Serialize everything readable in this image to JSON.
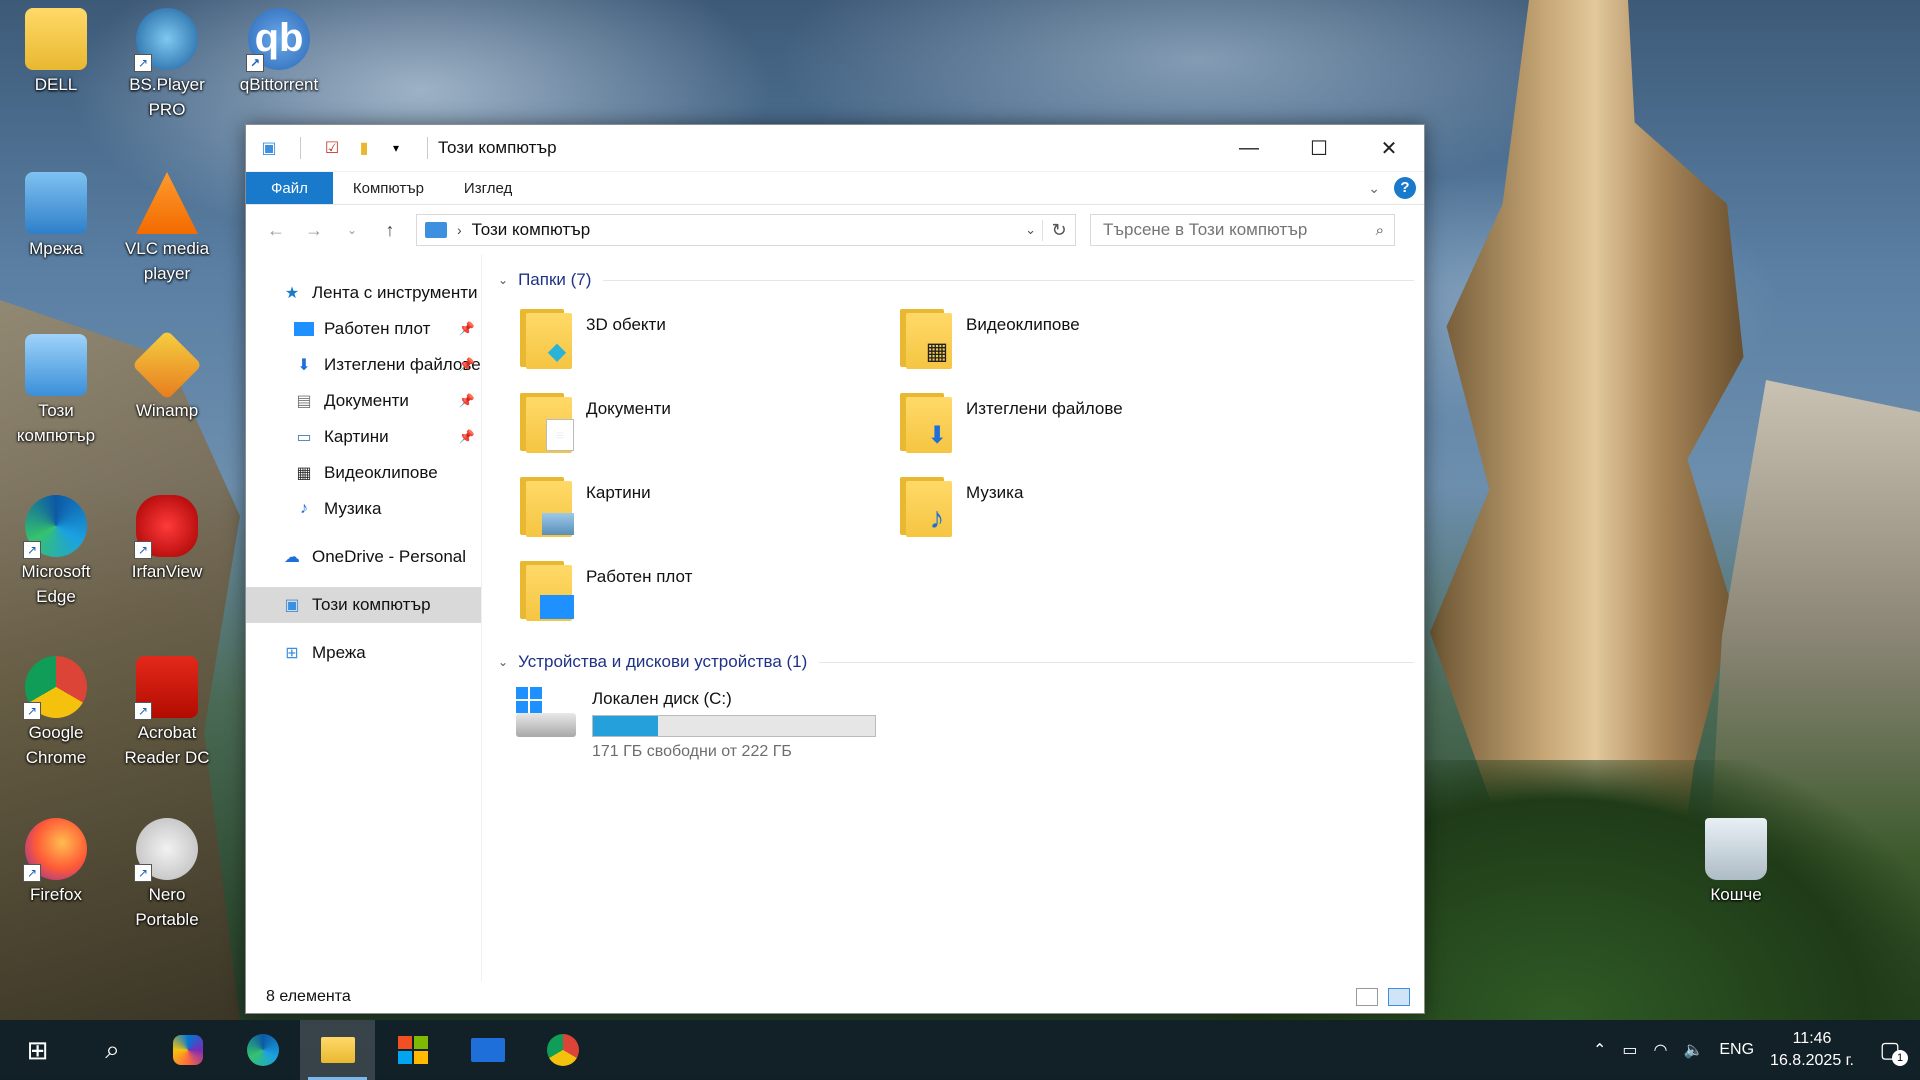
{
  "desktop": {
    "icons": [
      {
        "label": "DELL",
        "icon": "user-folder-icon"
      },
      {
        "label": "BS.Player PRO",
        "icon": "bsplayer-icon"
      },
      {
        "label": "qBittorrent",
        "icon": "qbittorrent-icon"
      },
      {
        "label": "Мрежа",
        "icon": "network-icon"
      },
      {
        "label": "VLC media player",
        "icon": "vlc-icon"
      },
      {
        "label": "Този компютър",
        "icon": "this-pc-icon"
      },
      {
        "label": "Winamp",
        "icon": "winamp-icon"
      },
      {
        "label": "Microsoft Edge",
        "icon": "edge-icon"
      },
      {
        "label": "IrfanView",
        "icon": "irfanview-icon"
      },
      {
        "label": "Google Chrome",
        "icon": "chrome-icon"
      },
      {
        "label": "Acrobat Reader DC",
        "icon": "acrobat-icon"
      },
      {
        "label": "Firefox",
        "icon": "firefox-icon"
      },
      {
        "label": "Nero Portable",
        "icon": "nero-icon"
      },
      {
        "label": "Кошче",
        "icon": "recycle-bin-icon"
      }
    ]
  },
  "window": {
    "title": "Този компютър",
    "ribbon_tabs": [
      "Файл",
      "Компютър",
      "Изглед"
    ],
    "address": {
      "location": "Този компютър"
    },
    "search": {
      "placeholder": "Търсене в Този компютър"
    },
    "nav_pane": {
      "quick_access": "Лента с инструменти",
      "pinned": [
        "Работен плот",
        "Изтеглени файлове",
        "Документи",
        "Картини"
      ],
      "unpinned": [
        "Видеоклипове",
        "Музика"
      ],
      "onedrive": "OneDrive - Personal",
      "this_pc": "Този компютър",
      "network": "Мрежа"
    },
    "folders_group": "Папки (7)",
    "folders": [
      "3D обекти",
      "Видеоклипове",
      "Документи",
      "Изтеглени файлове",
      "Картини",
      "Музика",
      "Работен плот"
    ],
    "devices_group": "Устройства и дискови устройства (1)",
    "drive": {
      "name": "Локален диск (C:)",
      "free_text": "171 ГБ свободни от 222 ГБ",
      "used_fraction": 0.23
    },
    "status_text": "8 елемента"
  },
  "taskbar": {
    "items": [
      "start-icon",
      "search-icon",
      "copilot-icon",
      "edge-icon",
      "file-explorer-icon",
      "store-icon",
      "mail-icon",
      "chrome-icon"
    ],
    "active": "file-explorer-icon",
    "tray": {
      "language": "ENG",
      "time": "11:46",
      "date": "16.8.2025 г.",
      "notifications": "1"
    }
  },
  "colors": {
    "accent": "#1979ca",
    "drive_bar": "#26a0da",
    "group_header": "#1e3287"
  }
}
